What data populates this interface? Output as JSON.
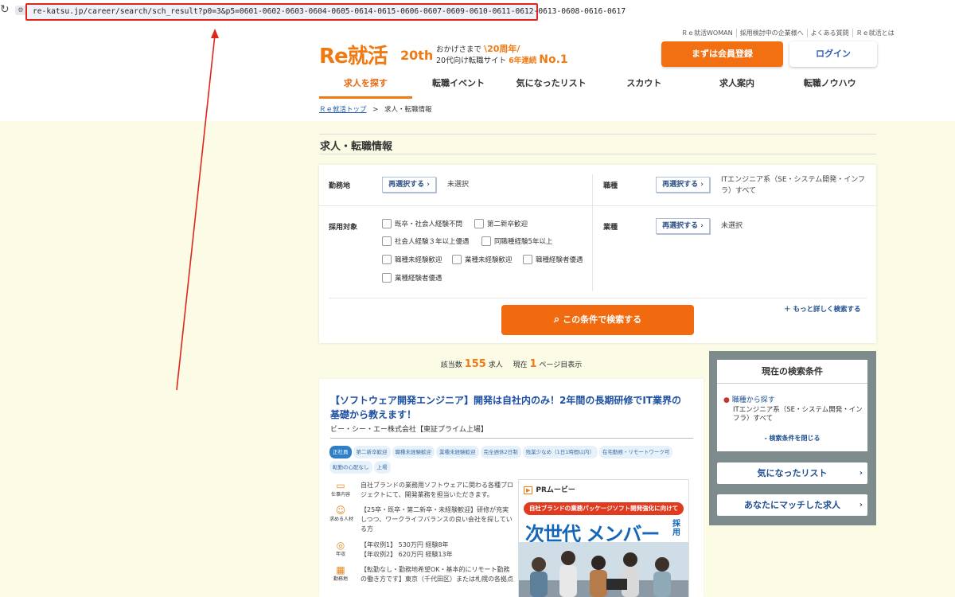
{
  "browser": {
    "reload_icon": "reload-icon",
    "site_info_icon": "site-info-icon",
    "url": "re-katsu.jp/career/search/sch_result?p0=3&p5=0601-0602-0603-0604-0605-0614-0615-0606-0607-0609-0610-0611-0612-0613-0608-0616-0617"
  },
  "header": {
    "top_links": [
      "Ｒｅ就活WOMAN",
      "採用検討中の企業様へ",
      "よくある質問",
      "Ｒｅ就活とは"
    ],
    "logo_text": "Re就活",
    "logo_badge": "20th",
    "tagline_line1_prefix": "おかげさまで",
    "tagline_line1_highlight": "\\20周年/",
    "tagline_line2_prefix": "20代向け転職サイト",
    "tagline_line2_highlight": "6年連続",
    "tagline_no1": "No.1",
    "register_button": "まずは会員登録",
    "login_button": "ログイン"
  },
  "nav": {
    "items": [
      {
        "label": "求人を探す"
      },
      {
        "label": "転職イベント"
      },
      {
        "label": "気になったリスト"
      },
      {
        "label": "スカウト"
      },
      {
        "label": "求人案内"
      },
      {
        "label": "転職ノウハウ"
      }
    ],
    "active_index": 0
  },
  "breadcrumb": {
    "home": "Ｒｅ就活トップ",
    "separator": ">",
    "current": "求人・転職情報"
  },
  "section_title": "求人・転職情報",
  "search_form": {
    "reselect_label": "再選択する",
    "location": {
      "label": "勤務地",
      "value": "未選択"
    },
    "job_type": {
      "label": "職種",
      "value": "ITエンジニア系（SE・システム開発・インフラ）すべて"
    },
    "target": {
      "label": "採用対象",
      "options": [
        "既卒・社会人経験不問",
        "第二新卒歓迎",
        "社会人経験３年以上優遇",
        "同職種経験5年以上",
        "職種未経験歓迎",
        "業種未経験歓迎",
        "職種経験者優遇",
        "業種経験者優遇"
      ]
    },
    "industry": {
      "label": "業種",
      "value": "未選択"
    },
    "search_button": "この条件で検索する",
    "search_icon": "search-icon",
    "more_search": "＋ もっと詳しく検索する"
  },
  "results": {
    "prefix": "該当数",
    "count": "155",
    "unit": "求人",
    "page_prefix": "現在",
    "page": "1",
    "page_suffix": "ページ目表示"
  },
  "job": {
    "title": "【ソフトウェア開発エンジニア】開発は自社内のみ！2年間の長期研修でIT業界の基礎から教えます！",
    "company": "ビー・シー・エー株式会社【東証プライム上場】",
    "tags": [
      "正社員",
      "第二新卒歓迎",
      "職種未経験歓迎",
      "業種未経験歓迎",
      "完全週休2日制",
      "残業少なめ（1日1時間以内）",
      "在宅勤務・リモートワーク可",
      "転勤の心配なし",
      "上場"
    ],
    "info": [
      {
        "icon": "briefcase-icon",
        "label": "仕事内容",
        "text": "自社ブランドの業務用ソフトウェアに関わる各種プロジェクトにて、開発業務を担当いただきます。"
      },
      {
        "icon": "person-icon",
        "label": "求める人材",
        "text": "【25卒・既卒・第二新卒・未経験歓迎】研修が充実しつつ、ワークライフバランスの良い会社を探している方"
      },
      {
        "icon": "coin-icon",
        "label": "年収",
        "text": "【年収例1】 530万円 経験8年\n【年収例2】 620万円 経験13年"
      },
      {
        "icon": "map-icon",
        "label": "勤務地",
        "text": "【転勤なし・勤務地希望OK・基本的にリモート勤務の働き方です】東京（千代田区）または札幌の各拠点"
      }
    ],
    "pr": {
      "heading": "PRムービー",
      "banner": "自社ブランドの業務パッケージソフト開発強化に向けて",
      "headline": "次世代 メンバー",
      "side_word": "採用"
    }
  },
  "sidebar": {
    "current_title": "現在の検索条件",
    "criteria_label": "職種から探す",
    "criteria_value": "ITエンジニア系（SE・システム開発・インフラ）すべて",
    "close_label": "- 検索条件を閉じる",
    "saved_list_button": "気になったリスト",
    "matched_button": "あなたにマッチした求人"
  }
}
